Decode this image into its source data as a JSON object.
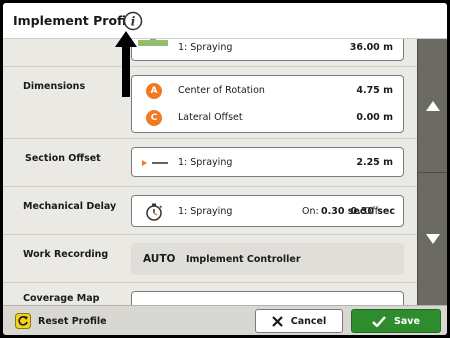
{
  "header": {
    "title": "Implement Profile"
  },
  "top_row": {
    "label": "1: Spraying",
    "value": "36.00 m"
  },
  "dimensions": {
    "label": "Dimensions",
    "items": [
      {
        "badge": "A",
        "label": "Center of Rotation",
        "value": "4.75 m"
      },
      {
        "badge": "C",
        "label": "Lateral Offset",
        "value": "0.00 m"
      }
    ]
  },
  "section_offset": {
    "label": "Section Offset",
    "item_label": "1: Spraying",
    "value": "2.25 m"
  },
  "mechanical_delay": {
    "label": "Mechanical Delay",
    "item_label": "1: Spraying",
    "on_label": "On:",
    "on_value": "0.30 sec",
    "off_label": "Off:",
    "off_value": "0.30 sec"
  },
  "work_recording": {
    "label": "Work Recording",
    "mode": "AUTO",
    "source": "Implement Controller"
  },
  "coverage_map": {
    "label": "Coverage Map"
  },
  "footer": {
    "reset_label": "Reset Profile",
    "cancel_label": "Cancel",
    "save_label": "Save"
  },
  "colors": {
    "accent_orange": "#f07a22",
    "save_green": "#2e8b2e",
    "scrollbar": "#6b6a63",
    "background": "#ebe9e4"
  },
  "icons": [
    "info-icon",
    "up-arrow-icon",
    "down-arrow-icon",
    "section-offset-icon",
    "timer-icon",
    "reset-icon",
    "cancel-x-icon",
    "checkmark-icon"
  ]
}
